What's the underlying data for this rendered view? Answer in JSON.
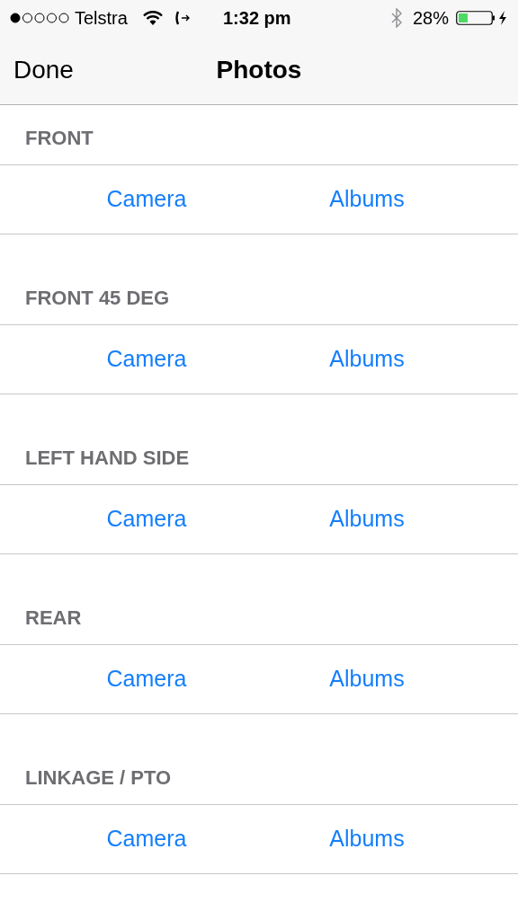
{
  "status_bar": {
    "carrier": "Telstra",
    "time": "1:32 pm",
    "battery": "28%"
  },
  "nav_bar": {
    "left_button": "Done",
    "title": "Photos"
  },
  "sections": [
    {
      "header": "FRONT",
      "actions": [
        "Camera",
        "Albums"
      ]
    },
    {
      "header": "FRONT 45 DEG",
      "actions": [
        "Camera",
        "Albums"
      ]
    },
    {
      "header": "LEFT HAND SIDE",
      "actions": [
        "Camera",
        "Albums"
      ]
    },
    {
      "header": "REAR",
      "actions": [
        "Camera",
        "Albums"
      ]
    },
    {
      "header": "LINKAGE / PTO",
      "actions": [
        "Camera",
        "Albums"
      ]
    }
  ]
}
